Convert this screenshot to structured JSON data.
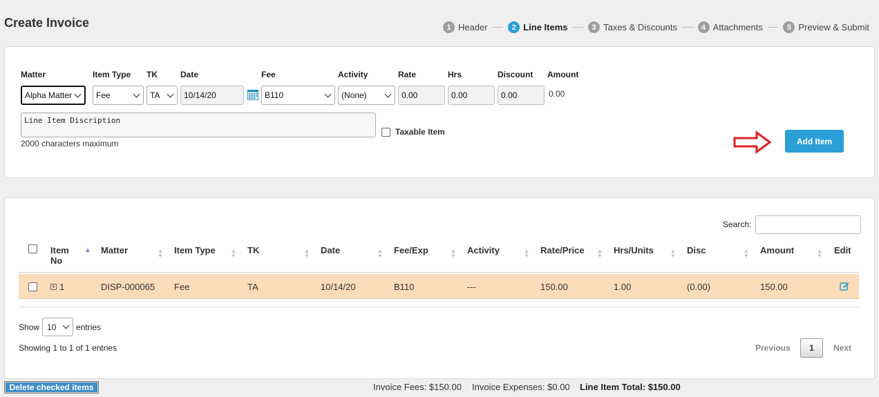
{
  "page_title": "Create Invoice",
  "steps": [
    {
      "num": "1",
      "label": "Header"
    },
    {
      "num": "2",
      "label": "Line Items"
    },
    {
      "num": "3",
      "label": "Taxes & Discounts"
    },
    {
      "num": "4",
      "label": "Attachments"
    },
    {
      "num": "5",
      "label": "Preview & Submit"
    }
  ],
  "active_step": 2,
  "form": {
    "labels": {
      "matter": "Matter",
      "item_type": "Item Type",
      "tk": "TK",
      "date": "Date",
      "fee": "Fee",
      "activity": "Activity",
      "rate": "Rate",
      "hrs": "Hrs",
      "discount": "Discount",
      "amount": "Amount"
    },
    "values": {
      "matter": "Alpha Matter",
      "item_type": "Fee",
      "tk": "TA",
      "date": "10/14/20",
      "fee": "B110",
      "activity": "(None)",
      "rate": "0.00",
      "hrs": "0.00",
      "discount": "0.00",
      "amount": "0.00"
    },
    "description_placeholder": "Line Item Discription",
    "description_hint": "2000 characters maximum",
    "taxable_label": "Taxable Item",
    "add_button": "Add Item"
  },
  "table": {
    "search_label": "Search:",
    "columns": [
      {
        "key": "item_no",
        "label": "Item No"
      },
      {
        "key": "matter",
        "label": "Matter"
      },
      {
        "key": "item_type",
        "label": "Item Type"
      },
      {
        "key": "tk",
        "label": "TK"
      },
      {
        "key": "date",
        "label": "Date"
      },
      {
        "key": "fee_exp",
        "label": "Fee/Exp"
      },
      {
        "key": "activity",
        "label": "Activity"
      },
      {
        "key": "rate",
        "label": "Rate/Price"
      },
      {
        "key": "hrs",
        "label": "Hrs/Units"
      },
      {
        "key": "disc",
        "label": "Disc"
      },
      {
        "key": "amount",
        "label": "Amount"
      },
      {
        "key": "edit",
        "label": "Edit"
      }
    ],
    "sorted_column": "item_no",
    "rows": [
      {
        "item_no": "1",
        "matter": "DISP-000065",
        "item_type": "Fee",
        "tk": "TA",
        "date": "10/14/20",
        "fee_exp": "B110",
        "activity": "---",
        "rate": "150.00",
        "hrs": "1.00",
        "disc": "(0.00)",
        "amount": "150.00"
      }
    ],
    "show_label": "Show",
    "page_size": "10",
    "entries_label": "entries",
    "info": "Showing 1 to 1 of 1 entries",
    "prev": "Previous",
    "current_page": "1",
    "next": "Next"
  },
  "footer": {
    "delete_button": "Delete checked items",
    "invoice_fees": "Invoice Fees: $150.00",
    "invoice_expenses": "Invoice Expenses: $0.00",
    "line_item_total": "Line Item Total: $150.00"
  },
  "colors": {
    "accent": "#2a9fd6",
    "row_highlight": "#fcdcb9",
    "arrow": "#e02020"
  }
}
